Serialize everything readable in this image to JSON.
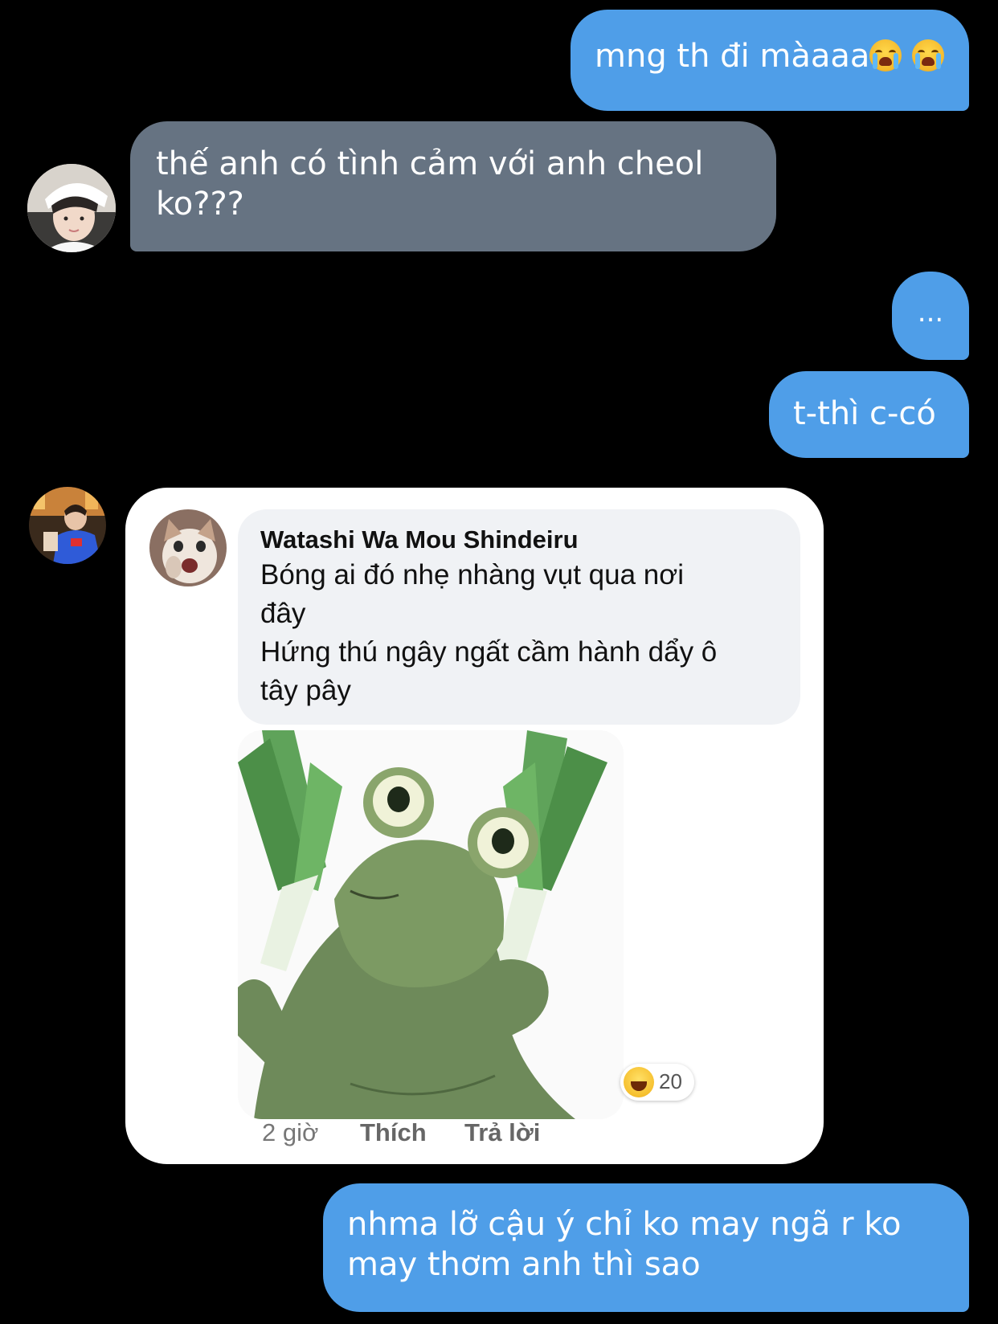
{
  "messages": [
    {
      "side": "me",
      "text": "mng th đi màaaa"
    },
    {
      "side": "them",
      "text": "thế anh có tình cảm với anh cheol ko???"
    },
    {
      "side": "me",
      "text": "..."
    },
    {
      "side": "me",
      "text": "t-thì c-có"
    },
    {
      "side": "me",
      "text": "nhma lỡ cậu ý chỉ ko may ngã r ko may thơm anh thì sao"
    }
  ],
  "messages_lines": {
    "m2_line1": "thế anh có tình cảm với anh cheol",
    "m2_line2": "ko???",
    "m5_line1": "nhma lỡ cậu ý chỉ ko may ngã r ko",
    "m5_line2": "may thơm anh thì sao"
  },
  "emojis": [
    "loudly-crying-face-icon",
    "loudly-crying-face-icon"
  ],
  "screenshot_card": {
    "commenter_name": "Watashi Wa Mou Shindeiru",
    "comment_lines": [
      "Bóng ai đó nhẹ nhàng vụt qua nơi",
      "đây",
      "Hứng thú ngây ngất cầm hành dẩy ô",
      "tây pây"
    ],
    "time": "2 giờ",
    "like_label": "Thích",
    "reply_label": "Trả lời",
    "reaction_icon": "laughing-face-icon",
    "reaction_count": "20",
    "image": "frog-holding-green-onions"
  },
  "colors": {
    "outgoing_bubble": "#4f9ee8",
    "incoming_bubble": "#667382",
    "background": "#000000"
  }
}
